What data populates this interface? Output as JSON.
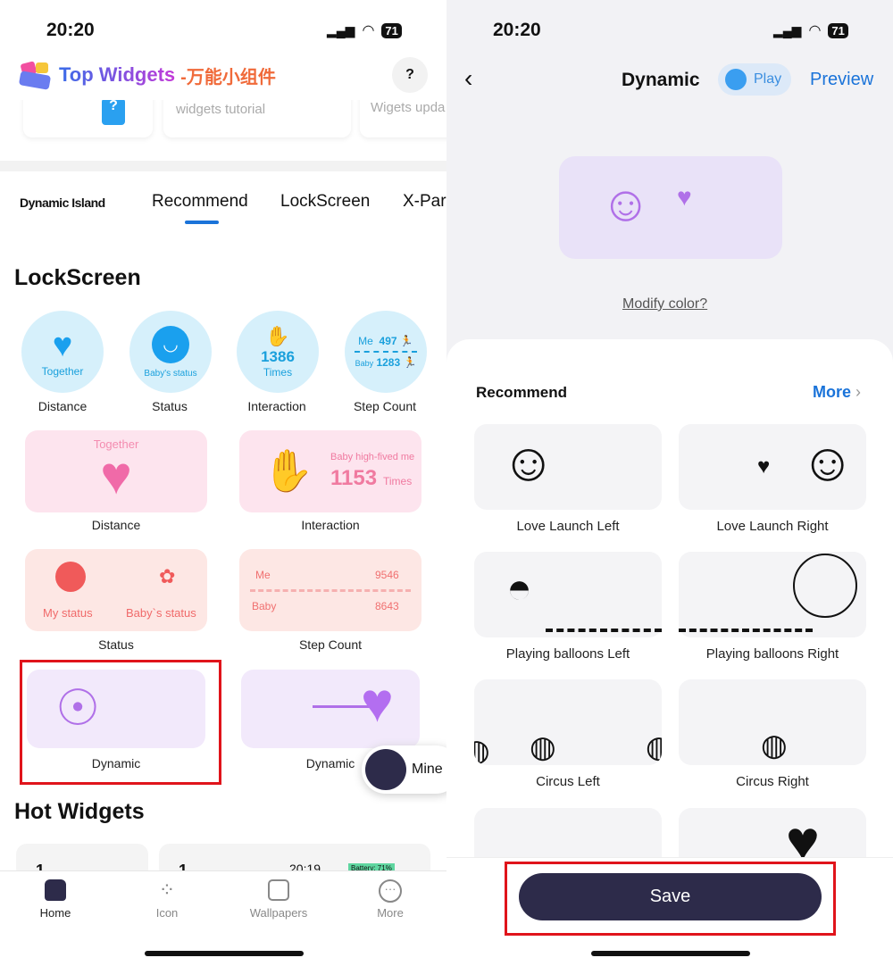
{
  "left": {
    "status": {
      "time": "20:20",
      "battery": "71"
    },
    "app_title": "Top Widgets",
    "app_title_cn": "-万能小组件",
    "banners": [
      "widgets tutorial",
      "Wigets upda"
    ],
    "tabs": [
      {
        "label": "Dynamic Island"
      },
      {
        "label": "Recommend",
        "active": true
      },
      {
        "label": "LockScreen"
      },
      {
        "label": "X-Par"
      }
    ],
    "section_lockscreen": "LockScreen",
    "circle_widgets": [
      {
        "label": "Distance",
        "inner": "Together"
      },
      {
        "label": "Status",
        "inner": "Baby's status"
      },
      {
        "label": "Interaction",
        "inner_num": "1386",
        "inner": "Times"
      },
      {
        "label": "Step Count",
        "me": "Me",
        "me_val": "497",
        "baby": "Baby",
        "baby_val": "1283"
      }
    ],
    "rect_widgets": [
      {
        "label": "Distance",
        "inner": "Together"
      },
      {
        "label": "Interaction",
        "inner": "Baby high-fived me",
        "num": "1153",
        "unit": "Times"
      },
      {
        "label": "Status",
        "a": "My status",
        "b": "Baby`s status"
      },
      {
        "label": "Step Count",
        "me": "Me",
        "me_val": "9546",
        "baby": "Baby",
        "baby_val": "8643"
      },
      {
        "label": "Dynamic",
        "highlighted": true
      },
      {
        "label": "Dynamic"
      }
    ],
    "mine_button": "Mine",
    "section_hot": "Hot Widgets",
    "hot_preview": [
      "1",
      "1",
      "20:19",
      "Battery: 71%"
    ],
    "nav": [
      {
        "label": "Home",
        "icon": "home-icon",
        "active": true
      },
      {
        "label": "Icon",
        "icon": "grid-icon"
      },
      {
        "label": "Wallpapers",
        "icon": "image-icon"
      },
      {
        "label": "More",
        "icon": "more-icon"
      }
    ]
  },
  "right": {
    "status": {
      "time": "20:20",
      "battery": "71"
    },
    "title": "Dynamic",
    "play_label": "Play",
    "preview_label": "Preview",
    "modify_color": "Modify color?",
    "section": "Recommend",
    "more": "More",
    "items": [
      "Love Launch Left",
      "Love Launch Right",
      "Playing balloons Left",
      "Playing balloons Right",
      "Circus Left",
      "Circus Right"
    ],
    "save": "Save"
  },
  "colors": {
    "accent": "#1a73d9",
    "highlight": "#e0141b",
    "save_bg": "#2d2b4a",
    "purple": "#b070e8"
  }
}
